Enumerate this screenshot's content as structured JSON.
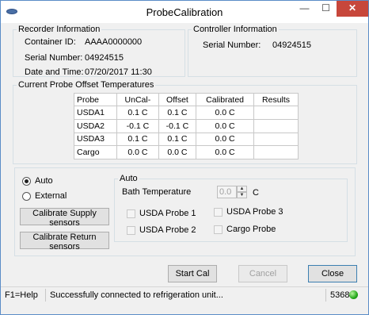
{
  "window": {
    "title": "ProbeCalibration"
  },
  "recorder": {
    "legend": "Recorder Information",
    "container_label": "Container ID:",
    "container_value": "AAAA0000000",
    "serial_label": "Serial Number:",
    "serial_value": "04924515",
    "datetime_label": "Date and Time:",
    "datetime_value": "07/20/2017 11:30"
  },
  "controller": {
    "legend": "Controller Information",
    "serial_label": "Serial Number:",
    "serial_value": "04924515"
  },
  "offsets": {
    "legend": "Current Probe Offset Temperatures",
    "columns": [
      "Probe",
      "UnCal-",
      "Offset",
      "Calibrated",
      "Results"
    ],
    "rows": [
      [
        "USDA1",
        "0.1 C",
        "0.1 C",
        "0.0 C",
        ""
      ],
      [
        "USDA2",
        "-0.1 C",
        "-0.1 C",
        "0.0 C",
        ""
      ],
      [
        "USDA3",
        "0.1 C",
        "0.1 C",
        "0.0 C",
        ""
      ],
      [
        "Cargo",
        "0.0 C",
        "0.0 C",
        "0.0 C",
        ""
      ]
    ]
  },
  "mode": {
    "auto_label": "Auto",
    "external_label": "External",
    "selected": "Auto"
  },
  "buttons": {
    "calibrate_supply": "Calibrate Supply sensors",
    "calibrate_return": "Calibrate Return sensors",
    "start_cal": "Start Cal",
    "cancel": "Cancel",
    "close": "Close"
  },
  "auto_group": {
    "legend": "Auto",
    "bath_label": "Bath Temperature",
    "bath_value": "0.0",
    "bath_unit": "C",
    "probe1": "USDA Probe 1",
    "probe2": "USDA Probe 2",
    "probe3": "USDA Probe 3",
    "cargo": "Cargo Probe"
  },
  "status": {
    "help": "F1=Help",
    "message": "Successfully connected to refrigeration unit...",
    "code": "5368",
    "led_color": "#24a81a"
  }
}
